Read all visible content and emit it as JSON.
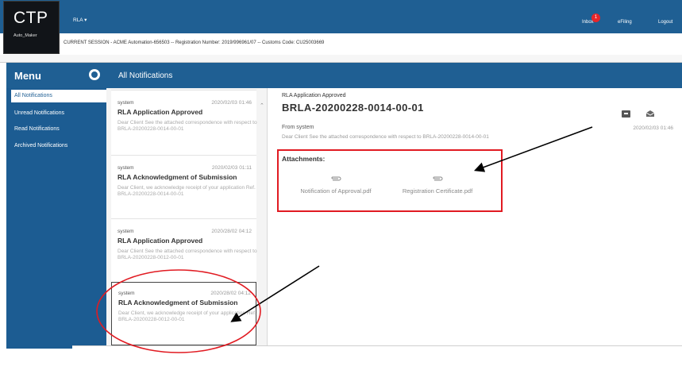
{
  "header": {
    "logo": "CTP",
    "logo_sub": "Auto_Maker",
    "rla_menu": "RLA ▾",
    "inbox": "Inbox",
    "inbox_count": "1",
    "efiling": "eFiling",
    "logout": "Logout"
  },
  "session": {
    "text": "CURRENT SESSION - ACME Automation-656503 -- Registration Number: 2019/996961/07 -- Customs Code: CU25003669"
  },
  "menu": {
    "title": "Menu",
    "items": [
      {
        "label": "All Notifications",
        "active": true
      },
      {
        "label": "Unread Notifications",
        "active": false
      },
      {
        "label": "Read Notifications",
        "active": false
      },
      {
        "label": "Archived Notifications",
        "active": false
      }
    ]
  },
  "content": {
    "title": "All Notifications"
  },
  "notifications": [
    {
      "sender": "system",
      "date": "2020/02/03 01:46",
      "title": "RLA Application Approved",
      "body": "Dear Client See the attached correspondence with respect to BRLA-20200228-0014-00-01"
    },
    {
      "sender": "system",
      "date": "2020/02/03 01:11",
      "title": "RLA Acknowledgment of Submission",
      "body": "Dear Client, we acknowledge receipt of your application Ref. BRLA-20200228-0014-00-01"
    },
    {
      "sender": "system",
      "date": "2020/28/02 04:12",
      "title": "RLA Application Approved",
      "body": "Dear Client See the attached correspondence with respect to BRLA-20200228-0012-00-01"
    },
    {
      "sender": "system",
      "date": "2020/28/02 04:12",
      "title": "RLA Acknowledgment of Submission",
      "body": "Dear Client, we acknowledge receipt of your application Ref. BRLA-20200228-0012-00-01"
    }
  ],
  "detail": {
    "label": "RLA Application Approved",
    "reference": "BRLA-20200228-0014-00-01",
    "from": "From system",
    "date": "2020/02/03 01:46",
    "body": "Dear Client See the attached correspondence with respect to BRLA-20200228-0014-00-01",
    "attachments_label": "Attachments:",
    "attachments": [
      {
        "name": "Notification of Approval.pdf",
        "icon": "paperclip-icon"
      },
      {
        "name": "Registration Certificate.pdf",
        "icon": "paperclip-icon"
      }
    ]
  },
  "colors": {
    "brand_blue": "#1f5f93",
    "highlight_red": "#e11b22",
    "badge_red": "#e8262a"
  }
}
